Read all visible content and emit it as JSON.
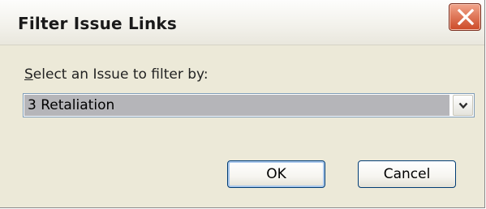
{
  "dialog": {
    "title": "Filter Issue Links",
    "close_icon": "close-icon",
    "label_prefix": "",
    "label_mnemonic": "S",
    "label_rest": "elect an Issue to filter by:",
    "select": {
      "selected_value": "3  Retaliation",
      "arrow_icon": "chevron-down-icon"
    },
    "ok_label": "OK",
    "cancel_label": "Cancel"
  },
  "colors": {
    "dialog_bg": "#ece9d8",
    "close_red": "#cc4a27",
    "select_highlight": "#b5b5b9",
    "button_border": "#003c74"
  }
}
